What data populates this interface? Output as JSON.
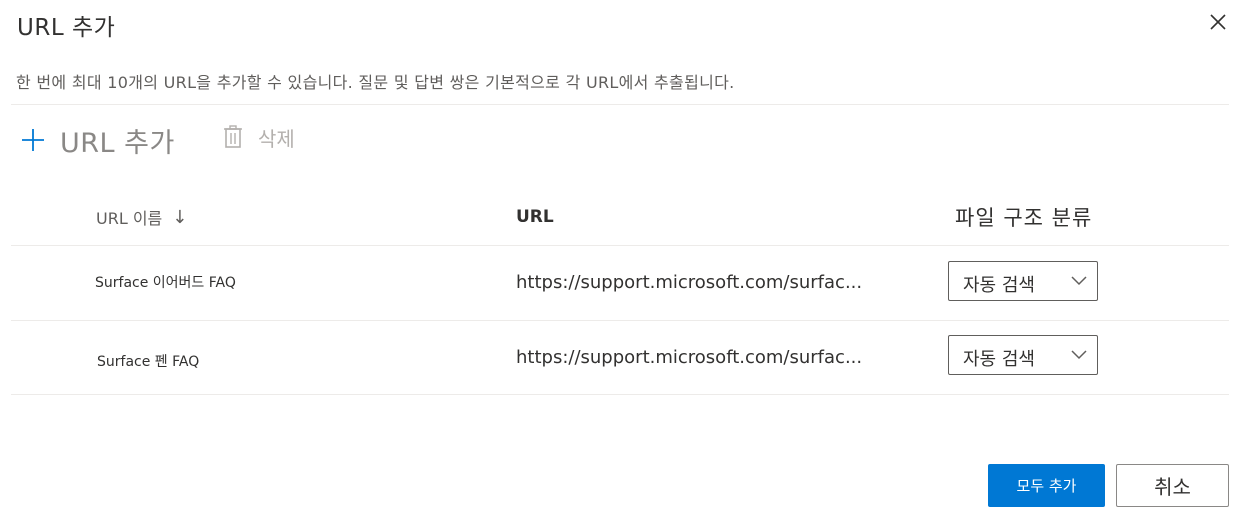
{
  "dialog": {
    "title": "URL 추가",
    "description": "한 번에 최대 10개의 URL을 추가할 수 있습니다. 질문 및 답변 쌍은 기본적으로 각 URL에서 추출됩니다.",
    "close_icon": "close-icon"
  },
  "commands": {
    "add_label": "URL 추가",
    "add_icon": "plus-icon",
    "delete_label": "삭제",
    "delete_icon": "trash-icon"
  },
  "table": {
    "columns": {
      "name": "URL 이름",
      "name_sort_icon": "arrow-down-icon",
      "url": "URL",
      "structure": "파일 구조 분류"
    },
    "rows": [
      {
        "name": "Surface 이어버드 FAQ",
        "url": "https://support.microsoft.com/surfac...",
        "structure": "자동 검색"
      },
      {
        "name": "Surface 펜 FAQ",
        "url": "https://support.microsoft.com/surfac...",
        "structure": "자동 검색"
      }
    ]
  },
  "footer": {
    "add_all_label": "모두 추가",
    "cancel_label": "취소"
  },
  "colors": {
    "primary": "#0078d4",
    "text": "#323130",
    "muted": "#605e5c",
    "disabled": "#b3b0ad",
    "divider": "#edebe9"
  }
}
